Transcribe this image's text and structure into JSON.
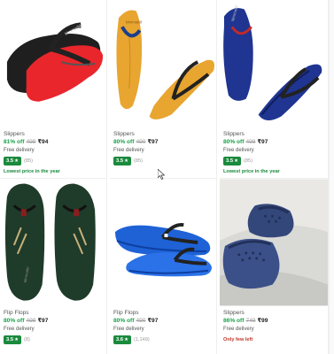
{
  "products": [
    {
      "name": "Slippers",
      "discount": "81% off",
      "mrp": "499",
      "price": "₹94",
      "delivery": "Free delivery",
      "rating": "3.5",
      "rating_count": "(85)",
      "tag": "Lowest price in the year",
      "tag_style": "green",
      "image": "red-flipflop"
    },
    {
      "name": "Slippers",
      "discount": "80% off",
      "mrp": "490",
      "price": "₹97",
      "delivery": "Free delivery",
      "rating": "3.5",
      "rating_count": "(85)",
      "tag": "",
      "tag_style": "",
      "image": "yellow-flipflop"
    },
    {
      "name": "Slippers",
      "discount": "80% off",
      "mrp": "499",
      "price": "₹97",
      "delivery": "Free delivery",
      "rating": "3.5",
      "rating_count": "(85)",
      "tag": "Lowest price in the year",
      "tag_style": "green",
      "image": "navy-flipflop"
    },
    {
      "name": "Flip Flops",
      "discount": "80% off",
      "mrp": "499",
      "price": "₹97",
      "delivery": "Free delivery",
      "rating": "3.5",
      "rating_count": "(8)",
      "tag": "",
      "tag_style": "",
      "image": "green-flipflop"
    },
    {
      "name": "Flip Flops",
      "discount": "80% off",
      "mrp": "490",
      "price": "₹97",
      "delivery": "Free delivery",
      "rating": "3.6",
      "rating_count": "(1,149)",
      "tag": "",
      "tag_style": "",
      "image": "blue-flipflop"
    },
    {
      "name": "Slippers",
      "discount": "86% off",
      "mrp": "749",
      "price": "₹99",
      "delivery": "Free delivery",
      "rating": "",
      "rating_count": "",
      "tag": "Only few left",
      "tag_style": "red",
      "image": "navy-slide"
    }
  ],
  "rating_star": "★"
}
